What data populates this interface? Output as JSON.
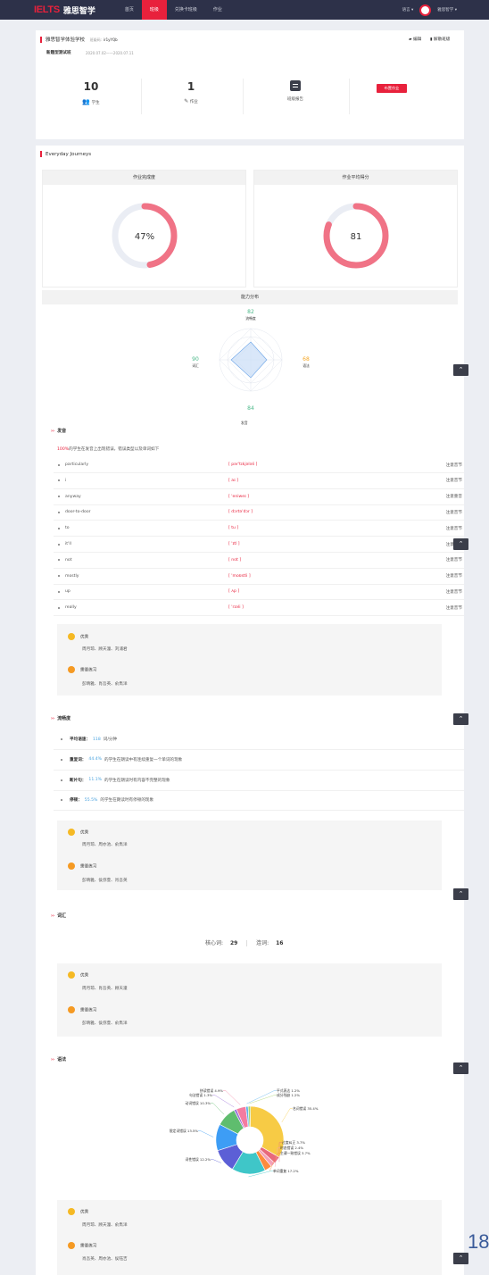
{
  "nav": {
    "logo_en": "IELTS",
    "logo_cn": "雅思智学",
    "items": [
      "首页",
      "班级",
      "兑换卡班级",
      "作业"
    ],
    "lang": "语言",
    "user": "雅思智学"
  },
  "class_info": {
    "school": "雅思智学体验学校",
    "code_label": "班级码:",
    "code": "ir1yYQb",
    "type": "新题型测试班",
    "dates": "2020.07.02——2020.07.11",
    "edit": "编辑",
    "dissolve": "解散班级",
    "students_count": "10",
    "students_label": "学生",
    "homework_count": "1",
    "homework_label": "作业",
    "report_label": "班级报告",
    "assign_button": "布置作业"
  },
  "journey": {
    "title": "Everyday Journeys",
    "completion_title": "作业完成度",
    "completion_value": "47%",
    "completion_fraction": 0.47,
    "avg_title": "作业平均得分",
    "avg_value": "81",
    "avg_fraction": 0.81,
    "ability_title": "能力分布",
    "radar": [
      {
        "name": "流畅度",
        "value": "82",
        "color": "#4cb98a"
      },
      {
        "name": "语法",
        "value": "68",
        "color": "#f5a623"
      },
      {
        "name": "发音",
        "value": "84",
        "color": "#4cb98a"
      },
      {
        "name": "词汇",
        "value": "90",
        "color": "#4cb98a"
      }
    ]
  },
  "pronunciation": {
    "title": "发音",
    "summary_pct": "100%",
    "summary_text": "的学生在发音上出现错误，错误类型以及单词如下",
    "rows": [
      {
        "word": "particularly",
        "ipa": "[ pər'tɪkjələli ]",
        "note": "注意音节"
      },
      {
        "word": "i",
        "ipa": "[ aɪ ]",
        "note": "注意音节"
      },
      {
        "word": "anyway",
        "ipa": "[ 'eniweɪ ]",
        "note": "注意重音"
      },
      {
        "word": "door-to-door",
        "ipa": "[ dɔrtə'dɔr ]",
        "note": "注意音节"
      },
      {
        "word": "to",
        "ipa": "[ tu ]",
        "note": "注意音节"
      },
      {
        "word": "it'll",
        "ipa": "[ 'ɪtl ]",
        "note": "注意音节"
      },
      {
        "word": "not",
        "ipa": "[ nɑt ]",
        "note": "注意音节"
      },
      {
        "word": "mostly",
        "ipa": "[ 'moʊstli ]",
        "note": "注意音节"
      },
      {
        "word": "up",
        "ipa": "[ ʌp ]",
        "note": "注意音节"
      },
      {
        "word": "really",
        "ipa": "[ 'rɪəli ]",
        "note": "注意音节"
      }
    ],
    "good_label": "优秀",
    "good_names": "周月琼、顾天潼、刘浦君",
    "practice_label": "需要练习",
    "practice_names": "彭晴雅、肖吾英、俞隽洋"
  },
  "fluency": {
    "title": "流畅度",
    "items": [
      {
        "label": "平均语速：",
        "value": "118",
        "text": "词/分钟"
      },
      {
        "label": "重复词：",
        "value": "44.4%",
        "text": "的学生在朗读中有连续重复一个单词的现象"
      },
      {
        "label": "断片句：",
        "value": "11.1%",
        "text": "的学生在朗读时有内容不完整的现象"
      },
      {
        "label": "停顿：",
        "value": "55.5%",
        "text": "的学生在朗读时有停顿的现象"
      }
    ],
    "good_label": "优秀",
    "good_names": "周月琼、周亦池、俞隽洋",
    "practice_label": "需要练习",
    "practice_names": "彭晴雅、侯弥萱、肖吾英"
  },
  "vocab": {
    "title": "词汇",
    "core_label": "核心词:",
    "core_value": "29",
    "link_label": "连词:",
    "link_value": "16",
    "good_label": "优秀",
    "good_names": "周月琼、肖吾英、顾天潼",
    "practice_label": "需要练习",
    "practice_names": "彭晴雅、侯弥萱、俞隽洋"
  },
  "grammar": {
    "title": "语法",
    "good_label": "优秀",
    "good_names": "周月琼、顾天潼、俞隽洋",
    "practice_label": "需要练习",
    "practice_names": "肖吾英、周亦池、侯钰吉"
  },
  "chart_data": {
    "type": "pie",
    "donut": true,
    "slices": [
      {
        "label": "名词错误",
        "value": 35.4,
        "color": "#f7cb45"
      },
      {
        "label": "过度纠正",
        "value": 3.7,
        "color": "#e8697b"
      },
      {
        "label": "时态错误",
        "value": 2.4,
        "color": "#f3a0b8"
      },
      {
        "label": "主谓一致错误",
        "value": 3.7,
        "color": "#fd8b3c"
      },
      {
        "label": "单词重复",
        "value": 17.2,
        "color": "#3fc6c8"
      },
      {
        "label": "词性错误",
        "value": 12.2,
        "color": "#5c5fd6"
      },
      {
        "label": "限定词错误",
        "value": 13.5,
        "color": "#3d9df5"
      },
      {
        "label": "动词错误",
        "value": 10.3,
        "color": "#5fbd6e"
      },
      {
        "label": "句法错误",
        "value": 1.3,
        "color": "#9b6fd9"
      },
      {
        "label": "拼读错误",
        "value": 4.9,
        "color": "#f37ca0"
      },
      {
        "label": "平式表达",
        "value": 1.2,
        "color": "#5ab1ee"
      },
      {
        "label": "成分残缺",
        "value": 1.2,
        "color": "#a7d470"
      }
    ],
    "labels_text": [
      "名词错误 35.4%",
      "过度纠正 3.7%",
      "时态错误 2.4%",
      "主谓一致错误 3.7%",
      "单词重复 17.2%",
      "词性错误 12.2%",
      "限定词错误 13.5%",
      "动词错误 10.3%",
      "句法错误 1.3%",
      "拼读错误 4.9%",
      "平式表达 1.2%",
      "成分残缺 1.2%"
    ]
  },
  "page_number": "18",
  "scroll_up_icon": "chevron-up-icon"
}
